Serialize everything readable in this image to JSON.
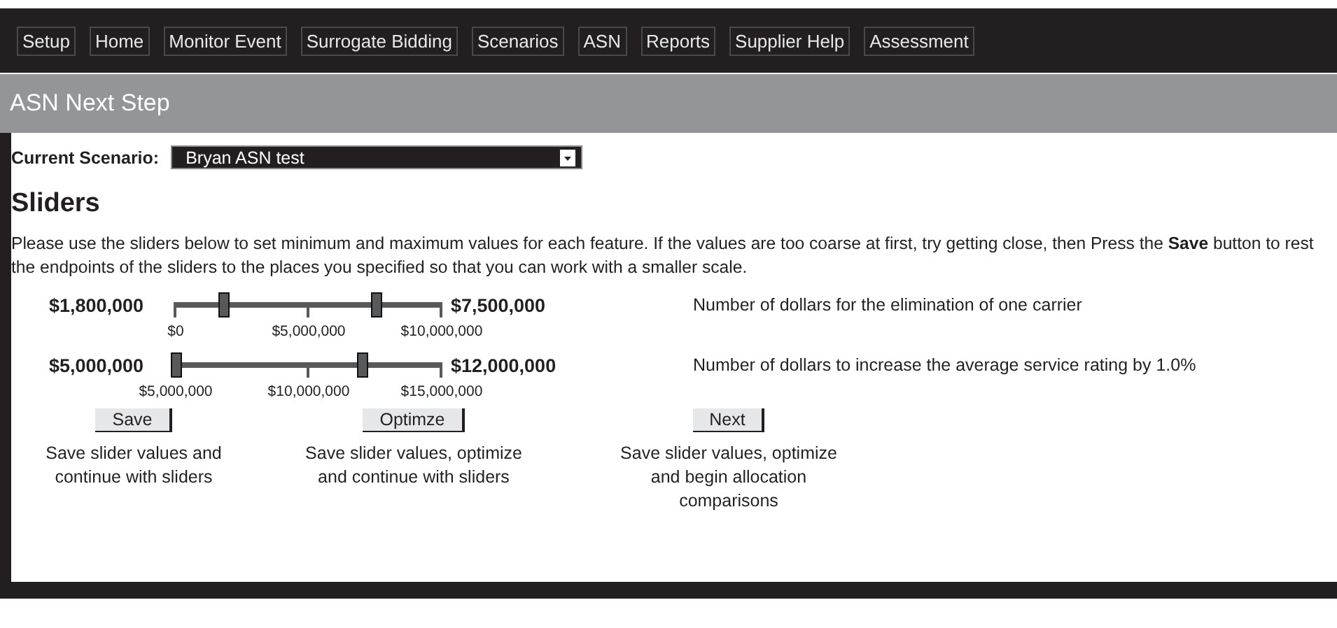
{
  "nav": [
    {
      "label": "Setup"
    },
    {
      "label": "Home"
    },
    {
      "label": "Monitor Event"
    },
    {
      "label": "Surrogate Bidding"
    },
    {
      "label": "Scenarios"
    },
    {
      "label": "ASN"
    },
    {
      "label": "Reports"
    },
    {
      "label": "Supplier Help"
    },
    {
      "label": "Assessment"
    }
  ],
  "page_title": "ASN Next Step",
  "scenario": {
    "label": "Current Scenario:",
    "value": "Bryan ASN test"
  },
  "heading": "Sliders",
  "instructions": "Please use the sliders below to set minimum and maximum values for each feature. If the values are too coarse at first, try getting close, then Press the **Save** button to rest the endpoints of the sliders to the places you specified so that you can work with a smaller scale.",
  "sliders": [
    {
      "low": "$1,800,000",
      "high": "$7,500,000",
      "thumbs": [
        {
          "level": 0.18
        },
        {
          "level": 0.75
        }
      ],
      "ticks": [
        "$0",
        "$5,000,000",
        "$10,000,000"
      ],
      "description": "Number of dollars for the elimination of one carrier"
    },
    {
      "low": "$5,000,000",
      "high": "$12,000,000",
      "thumbs": [
        {
          "level": 0
        },
        {
          "level": 0.7
        }
      ],
      "ticks": [
        "$5,000,000",
        "$10,000,000",
        "$15,000,000"
      ],
      "description": "Number of dollars to increase the average service rating by 1.0%"
    }
  ],
  "actions": [
    {
      "button": "Save",
      "description": "Save slider values and continue with sliders"
    },
    {
      "button": "Optimze",
      "description": "Save slider values, optimize and continue with sliders"
    },
    {
      "button": "Next",
      "description": "Save slider values, optimize and begin allocation comparisons"
    }
  ]
}
